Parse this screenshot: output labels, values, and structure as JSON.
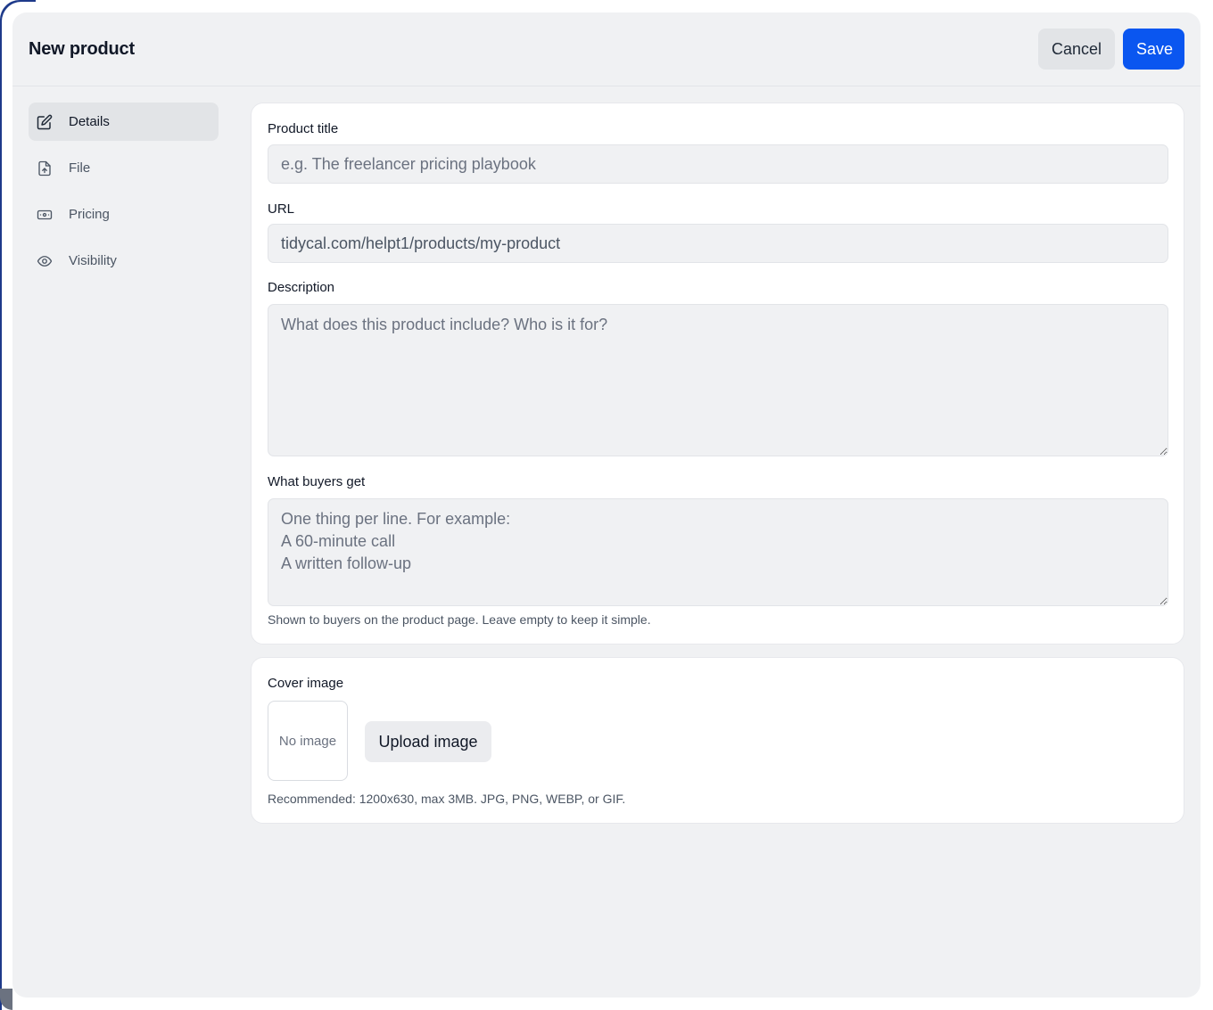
{
  "header": {
    "title": "New product",
    "cancel_label": "Cancel",
    "save_label": "Save"
  },
  "sidebar": {
    "items": [
      {
        "label": "Details",
        "icon": "edit-icon",
        "active": true
      },
      {
        "label": "File",
        "icon": "file-upload-icon",
        "active": false
      },
      {
        "label": "Pricing",
        "icon": "banknote-icon",
        "active": false
      },
      {
        "label": "Visibility",
        "icon": "eye-icon",
        "active": false
      }
    ]
  },
  "details": {
    "title_label": "Product title",
    "title_placeholder": "e.g. The freelancer pricing playbook",
    "url_label": "URL",
    "url_value": "tidycal.com/helpt1/products/my-product",
    "description_label": "Description",
    "description_placeholder": "What does this product include? Who is it for?",
    "buyers_label": "What buyers get",
    "buyers_placeholder": "One thing per line. For example:\nA 60-minute call\nA written follow-up",
    "buyers_help": "Shown to buyers on the product page. Leave empty to keep it simple."
  },
  "cover": {
    "label": "Cover image",
    "no_image": "No image",
    "upload_label": "Upload image",
    "help": "Recommended: 1200x630, max 3MB. JPG, PNG, WEBP, or GIF."
  },
  "colors": {
    "accent": "#0a56f0",
    "background": "#f0f1f3",
    "card": "#ffffff"
  }
}
